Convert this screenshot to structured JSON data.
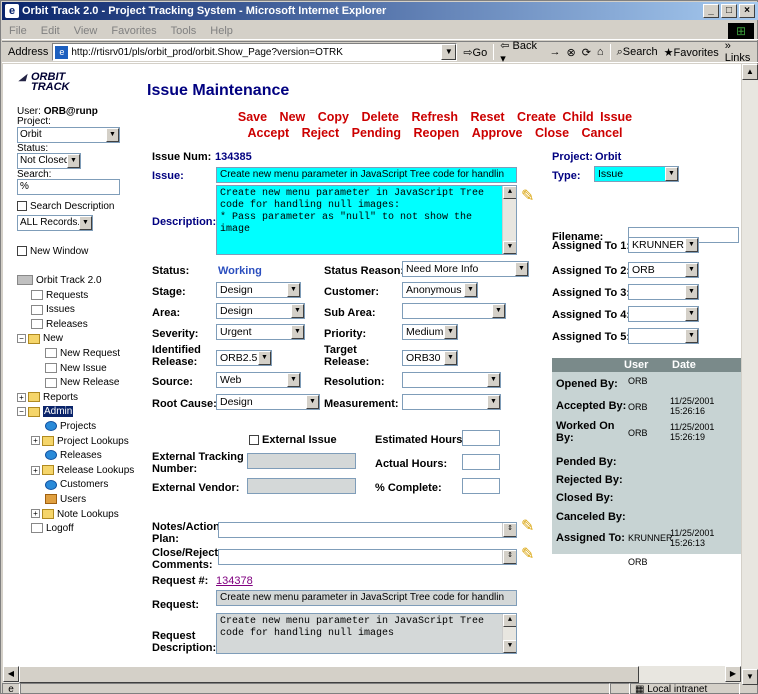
{
  "window": {
    "title": "Orbit Track 2.0 - Project Tracking System - Microsoft Internet Explorer"
  },
  "menu": [
    "File",
    "Edit",
    "View",
    "Favorites",
    "Tools",
    "Help"
  ],
  "toolbar": {
    "address_label": "Address",
    "url": "http://rtisrv01/pls/orbit_prod/orbit.Show_Page?version=OTRK",
    "go": "Go",
    "back": "Back",
    "forward": "→",
    "search": "Search",
    "favorites": "Favorites",
    "links": "Links"
  },
  "sidebar": {
    "logo": "ORBIT TRACK",
    "user_label": "User:",
    "user": "ORB@runp",
    "project_label": "Project:",
    "project": "Orbit",
    "status_label": "Status:",
    "status": "Not Closed",
    "search_label": "Search:",
    "search_value": "%",
    "search_desc_label": "Search Description",
    "records": "ALL Records...",
    "new_window_label": "New Window",
    "tree": [
      "Orbit Track 2.0",
      "Requests",
      "Issues",
      "Releases",
      "New",
      "New Request",
      "New Issue",
      "New Release",
      "Reports",
      "Admin",
      "Projects",
      "Project Lookups",
      "Releases",
      "Release Lookups",
      "Customers",
      "Users",
      "Note Lookups",
      "Logoff"
    ]
  },
  "main": {
    "title": "Issue Maintenance",
    "actions_row1": [
      "Save",
      "New",
      "Copy",
      "Delete",
      "Refresh",
      "Reset",
      "Create Child Issue"
    ],
    "actions_row2": [
      "Accept",
      "Reject",
      "Pending",
      "Reopen",
      "Approve",
      "Close",
      "Cancel"
    ],
    "issue_num_label": "Issue Num:",
    "issue_num": "134385",
    "project_label": "Project:",
    "project": "Orbit",
    "issue_label": "Issue:",
    "issue": "Create new menu parameter in JavaScript Tree code for handlin",
    "type_label": "Type:",
    "type": "Issue",
    "description_label": "Description:",
    "description": "Create new menu parameter in JavaScript Tree code for handling null images:\n* Pass parameter as \"null\" to not show the image",
    "filename_label": "Filename:",
    "filename": "",
    "status_label": "Status:",
    "status": "Working",
    "status_reason_label": "Status Reason:",
    "status_reason": "Need More Info",
    "stage_label": "Stage:",
    "stage": "Design",
    "customer_label": "Customer:",
    "customer": "Anonymous",
    "area_label": "Area:",
    "area": "Design",
    "sub_area_label": "Sub Area:",
    "sub_area": "",
    "severity_label": "Severity:",
    "severity": "Urgent",
    "priority_label": "Priority:",
    "priority": "Medium",
    "identified_release_label": "Identified Release:",
    "identified_release": "ORB2.5",
    "target_release_label": "Target Release:",
    "target_release": "ORB30",
    "source_label": "Source:",
    "source": "Web",
    "resolution_label": "Resolution:",
    "resolution": "",
    "root_cause_label": "Root Cause:",
    "root_cause": "Design",
    "measurement_label": "Measurement:",
    "measurement": "",
    "assigned": [
      {
        "label": "Assigned To 1:",
        "value": "KRUNNER"
      },
      {
        "label": "Assigned To 2:",
        "value": "ORB"
      },
      {
        "label": "Assigned To 3:",
        "value": ""
      },
      {
        "label": "Assigned To 4:",
        "value": ""
      },
      {
        "label": "Assigned To 5:",
        "value": ""
      }
    ],
    "external_issue_label": "External Issue",
    "estimated_hours_label": "Estimated Hours:",
    "external_tracking_label": "External Tracking Number:",
    "actual_hours_label": "Actual Hours:",
    "external_vendor_label": "External Vendor:",
    "complete_label": "% Complete:",
    "notes_label": "Notes/Action Plan:",
    "close_reject_label": "Close/Reject Comments:",
    "request_num_label": "Request #:",
    "request_num": "134378",
    "request_label": "Request:",
    "request": "Create new menu parameter in JavaScript Tree code for handlin",
    "request_desc_label": "Request Description:",
    "request_desc": "Create new menu parameter in JavaScript Tree code for handling null images"
  },
  "history": {
    "col_user": "User",
    "col_date": "Date",
    "rows": [
      {
        "label": "Opened By:",
        "user": "ORB",
        "date": ""
      },
      {
        "label": "Accepted By:",
        "user": "ORB",
        "date": "11/25/2001 15:26:16"
      },
      {
        "label": "Worked On By:",
        "user": "ORB",
        "date": "11/25/2001 15:26:19"
      },
      {
        "label": "Pended By:",
        "user": "",
        "date": ""
      },
      {
        "label": "Rejected By:",
        "user": "",
        "date": ""
      },
      {
        "label": "Closed By:",
        "user": "",
        "date": ""
      },
      {
        "label": "Canceled By:",
        "user": "",
        "date": ""
      },
      {
        "label": "Assigned To:",
        "user": "KRUNNER",
        "date": "11/25/2001 15:26:13"
      }
    ],
    "extra_user": "ORB"
  },
  "statusbar": {
    "zone": "Local intranet"
  }
}
